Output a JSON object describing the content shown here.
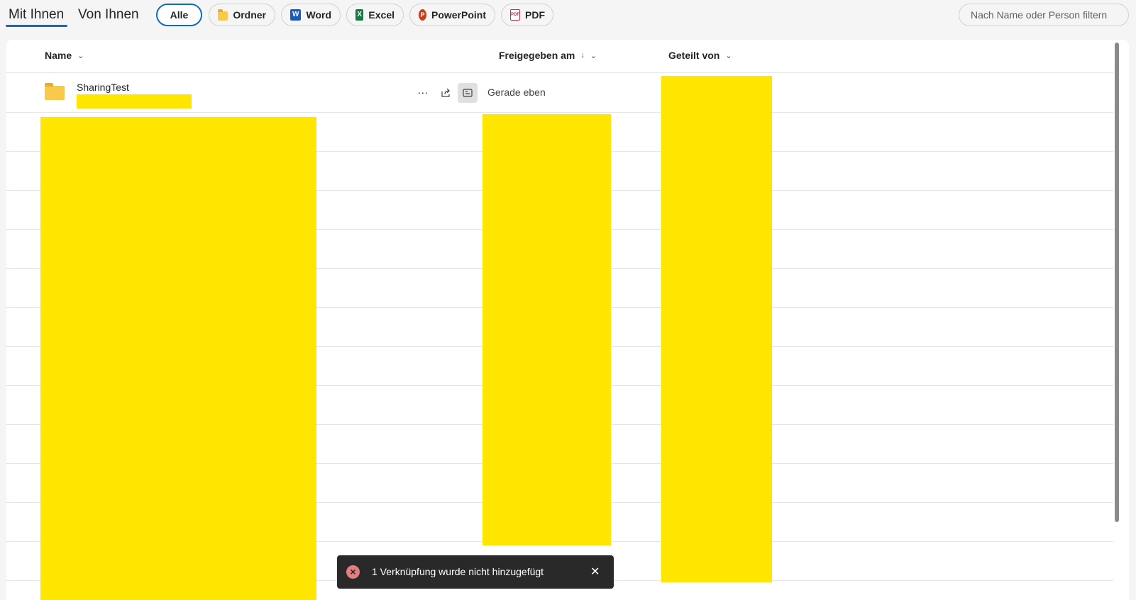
{
  "tabs": {
    "with_you": "Mit Ihnen",
    "by_you": "Von Ihnen"
  },
  "filters": [
    {
      "label": "Alle",
      "icon": "none",
      "selected": true
    },
    {
      "label": "Ordner",
      "icon": "folder-icon"
    },
    {
      "label": "Word",
      "icon": "word-icon"
    },
    {
      "label": "Excel",
      "icon": "excel-icon"
    },
    {
      "label": "PowerPoint",
      "icon": "powerpoint-icon"
    },
    {
      "label": "PDF",
      "icon": "pdf-icon"
    }
  ],
  "search": {
    "placeholder": "Nach Name oder Person filtern"
  },
  "columns": {
    "name": "Name",
    "shared_date": "Freigegeben am",
    "shared_by": "Geteilt von"
  },
  "rows": [
    {
      "name": "SharingTest",
      "shared_date": "Gerade eben"
    }
  ],
  "toast": {
    "message": "1 Verknüpfung wurde nicht hinzugefügt"
  },
  "colors": {
    "accent": "#0f6cbd",
    "redaction": "#ffe600",
    "toast_bg": "#292929"
  }
}
